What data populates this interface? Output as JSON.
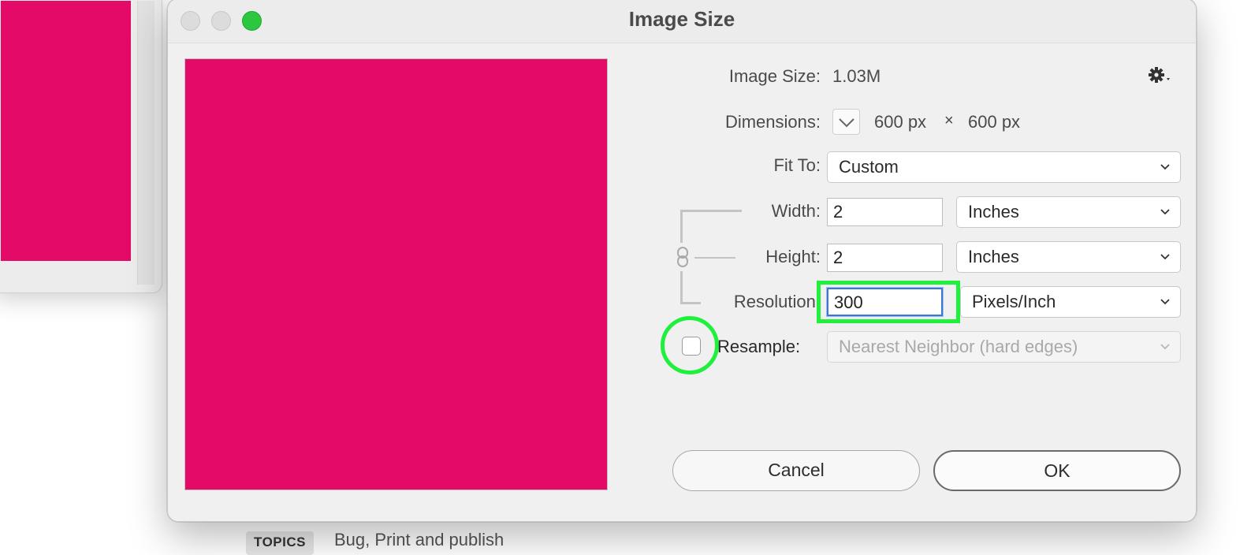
{
  "background": {
    "canvas_color": "#e30a68",
    "topics_tag": "TOPICS",
    "topics_text": "Bug, Print and publish"
  },
  "dialog": {
    "title": "Image Size",
    "preview_color": "#e30a68",
    "image_size": {
      "label": "Image Size:",
      "value": "1.03M"
    },
    "dimensions": {
      "label": "Dimensions:",
      "width": "600 px",
      "separator": "×",
      "height": "600 px"
    },
    "fit_to": {
      "label": "Fit To:",
      "value": "Custom"
    },
    "width": {
      "label": "Width:",
      "value": "2",
      "unit": "Inches"
    },
    "height": {
      "label": "Height:",
      "value": "2",
      "unit": "Inches"
    },
    "resolution": {
      "label": "Resolution:",
      "value": "300",
      "unit": "Pixels/Inch"
    },
    "resample": {
      "label": "Resample:",
      "checked": false,
      "method": "Nearest Neighbor (hard edges)"
    },
    "buttons": {
      "cancel": "Cancel",
      "ok": "OK"
    },
    "highlight_color": "#1ff03c"
  }
}
